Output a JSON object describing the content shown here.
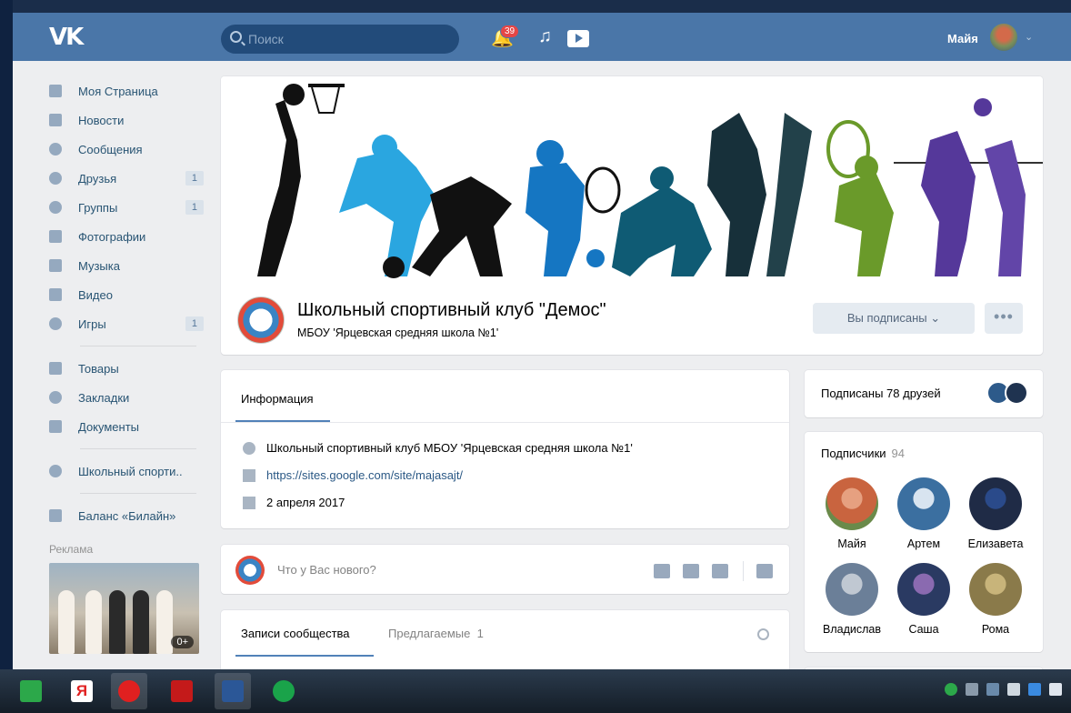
{
  "header": {
    "logo": "VK",
    "search_placeholder": "Поиск",
    "notifications_count": "39",
    "user_name": "Майя"
  },
  "sidebar": {
    "items": [
      {
        "label": "Моя Страница",
        "icon": "home-icon"
      },
      {
        "label": "Новости",
        "icon": "news-icon"
      },
      {
        "label": "Сообщения",
        "icon": "messages-icon"
      },
      {
        "label": "Друзья",
        "icon": "friends-icon",
        "count": "1"
      },
      {
        "label": "Группы",
        "icon": "groups-icon",
        "count": "1"
      },
      {
        "label": "Фотографии",
        "icon": "camera-icon"
      },
      {
        "label": "Музыка",
        "icon": "music-icon"
      },
      {
        "label": "Видео",
        "icon": "video-icon"
      },
      {
        "label": "Игры",
        "icon": "gamepad-icon",
        "count": "1"
      },
      {
        "label": "Товары",
        "icon": "bag-icon"
      },
      {
        "label": "Закладки",
        "icon": "star-icon"
      },
      {
        "label": "Документы",
        "icon": "document-icon"
      },
      {
        "label": "Школьный спорти..",
        "icon": "groups-icon"
      },
      {
        "label": "Баланс «Билайн»",
        "icon": "apps-icon"
      }
    ],
    "ad_label": "Реклама",
    "ad_badge": "0+"
  },
  "group": {
    "title": "Школьный спортивный клуб \"Демос\"",
    "subtitle": "МБОУ 'Ярцевская средняя школа №1'",
    "subscribe_button": "Вы подписаны",
    "more_button": "•••"
  },
  "info": {
    "tab": "Информация",
    "description": "Школьный спортивный клуб МБОУ 'Ярцевская средняя школа №1'",
    "link": "https://sites.google.com/site/majasajt/",
    "date": "2 апреля 2017"
  },
  "post_box": {
    "placeholder": "Что у Вас нового?"
  },
  "wall": {
    "tab_posts": "Записи сообщества",
    "tab_suggested": "Предлагаемые",
    "suggested_count": "1"
  },
  "friends_box": {
    "text": "Подписаны 78 друзей"
  },
  "subscribers": {
    "title": "Подписчики",
    "count": "94",
    "people": [
      {
        "name": "Майя",
        "color": "#c9643f"
      },
      {
        "name": "Артем",
        "color": "#3b6fa0"
      },
      {
        "name": "Елизавета",
        "color": "#1f2b46"
      },
      {
        "name": "Владислав",
        "color": "#6b7f98"
      },
      {
        "name": "Саша",
        "color": "#2a3a62"
      },
      {
        "name": "Рома",
        "color": "#8a7a4a"
      }
    ]
  },
  "colors": {
    "header": "#4a76a8",
    "link": "#2a5885",
    "accent": "#5181b8"
  }
}
